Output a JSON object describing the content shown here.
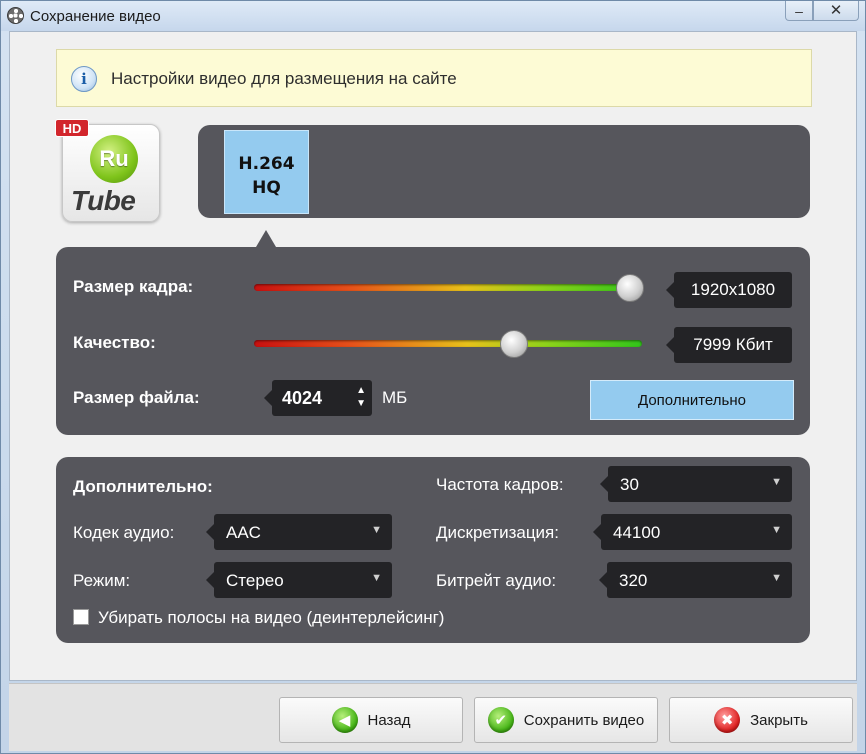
{
  "window": {
    "title": "Сохранение видео",
    "controls": {
      "minimize": "–",
      "close": "✕"
    }
  },
  "info": {
    "icon": "info-icon",
    "text": "Настройки видео для размещения на сайте"
  },
  "logo": {
    "badge": "HD",
    "circle_text": "Ru",
    "word": "Tube"
  },
  "format": {
    "tiles": [
      {
        "line1": "H.264",
        "line2": "HQ",
        "selected": true
      }
    ]
  },
  "settings": {
    "frame_size": {
      "label": "Размер кадра:",
      "value": "1920x1080",
      "slider_fraction": 0.98
    },
    "quality": {
      "label": "Качество:",
      "value": "7999 Кбит",
      "slider_fraction": 0.67
    },
    "file_size": {
      "label": "Размер файла:",
      "value": "4024",
      "unit": "МБ"
    },
    "more_button": "Дополнительно"
  },
  "advanced": {
    "title": "Дополнительно:",
    "audio_codec": {
      "label": "Кодек аудио:",
      "value": "AAC"
    },
    "mode": {
      "label": "Режим:",
      "value": "Стерео"
    },
    "frame_rate": {
      "label": "Частота кадров:",
      "value": "30"
    },
    "sampling": {
      "label": "Дискретизация:",
      "value": "44100"
    },
    "audio_bitrate": {
      "label": "Битрейт аудио:",
      "value": "320"
    },
    "deinterlace": {
      "label": "Убирать полосы на видео (деинтерлейсинг)",
      "checked": false
    }
  },
  "footer": {
    "back": "Назад",
    "save": "Сохранить видео",
    "close": "Закрыть"
  },
  "colors": {
    "panel": "#56565c",
    "accent": "#94cbef",
    "info_bg": "#fdfbd5"
  }
}
